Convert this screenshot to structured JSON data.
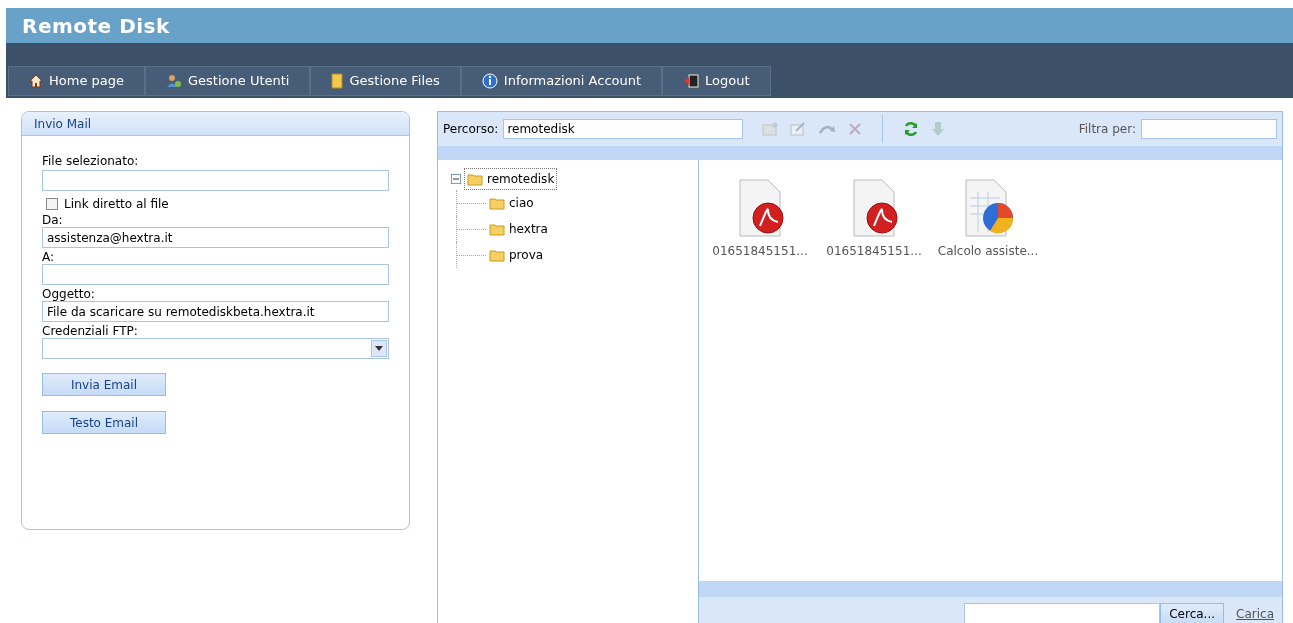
{
  "app_title": "Remote Disk",
  "nav": [
    {
      "label": "Home page",
      "kind": "home"
    },
    {
      "label": "Gestione Utenti",
      "kind": "users"
    },
    {
      "label": "Gestione Files",
      "kind": "files"
    },
    {
      "label": "Informazioni Account",
      "kind": "info"
    },
    {
      "label": "Logout",
      "kind": "logout"
    }
  ],
  "mail_panel": {
    "title": "Invio Mail",
    "file_label": "File selezionato:",
    "direct_link": {
      "label": "Link diretto al file",
      "checked": false
    },
    "from_label": "Da:",
    "from_value": "assistenza@hextra.it",
    "to_label": "A:",
    "subject_label": "Oggetto:",
    "subject_value": "File da scaricare su remotediskbeta.hextra.it",
    "ftp_label": "Credenziali FTP:",
    "buttons": [
      "Invia Email",
      "Testo Email"
    ]
  },
  "browser": {
    "path_label": "Percorso:",
    "path_value": "remotedisk",
    "toolbar": [
      {
        "kind": "new-folder",
        "disabled": true
      },
      {
        "kind": "edit",
        "disabled": true
      },
      {
        "kind": "redo",
        "disabled": true
      },
      {
        "kind": "delete",
        "disabled": true
      },
      {
        "kind": "separator"
      },
      {
        "kind": "refresh",
        "disabled": false
      },
      {
        "kind": "download",
        "disabled": true
      }
    ],
    "filter_label": "Filtra per:",
    "tree": {
      "label": "remotedisk",
      "expanded": true,
      "selected": true,
      "children": [
        {
          "label": "ciao",
          "selected": false
        },
        {
          "label": "hextra",
          "selected": false
        },
        {
          "label": "prova",
          "selected": false
        }
      ]
    },
    "files": [
      {
        "name": "01651845151...",
        "kind": "pdf"
      },
      {
        "name": "01651845151...",
        "kind": "pdf"
      },
      {
        "name": "Calcolo assiste...",
        "kind": "spreadsheet"
      }
    ],
    "browse_button": "Cerca...",
    "upload_link": "Carica"
  }
}
